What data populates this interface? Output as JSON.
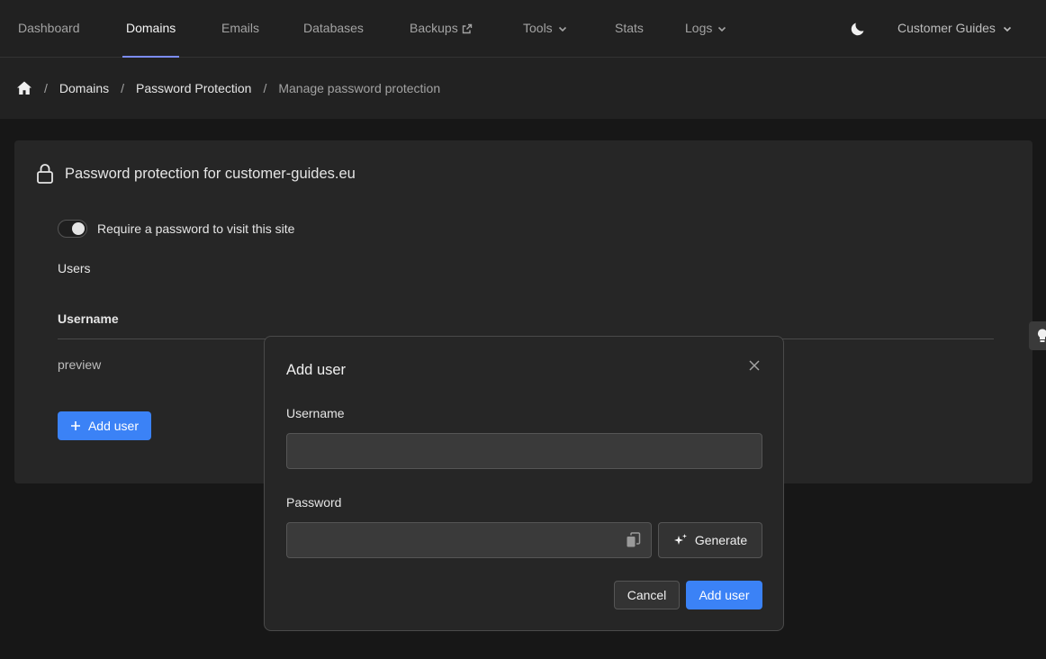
{
  "nav": {
    "items": [
      {
        "label": "Dashboard"
      },
      {
        "label": "Domains"
      },
      {
        "label": "Emails"
      },
      {
        "label": "Databases"
      },
      {
        "label": "Backups"
      },
      {
        "label": "Tools"
      },
      {
        "label": "Stats"
      },
      {
        "label": "Logs"
      }
    ],
    "active": "Domains",
    "account": "Customer Guides"
  },
  "breadcrumb": {
    "items": [
      "Domains",
      "Password Protection"
    ],
    "current": "Manage password protection"
  },
  "card": {
    "title": "Password protection for customer-guides.eu",
    "toggle_label": "Require a password to visit this site",
    "toggle_on": true,
    "users_label": "Users",
    "table": {
      "columns": [
        "Username"
      ],
      "rows": [
        [
          "preview"
        ]
      ]
    },
    "add_user_label": "Add user"
  },
  "modal": {
    "title": "Add user",
    "username_label": "Username",
    "username_value": "",
    "password_label": "Password",
    "password_value": "",
    "generate_label": "Generate",
    "cancel_label": "Cancel",
    "submit_label": "Add user"
  },
  "colors": {
    "accent": "#3b82f6",
    "active_tab_underline": "#7c8cf8",
    "background": "#171717",
    "panel": "#262626"
  },
  "icons": [
    "home-icon",
    "lock-icon",
    "plus-icon",
    "close-icon",
    "copy-icon",
    "sparkles-icon",
    "moon-icon",
    "external-link-icon",
    "chevron-down-icon",
    "lightbulb-icon"
  ]
}
